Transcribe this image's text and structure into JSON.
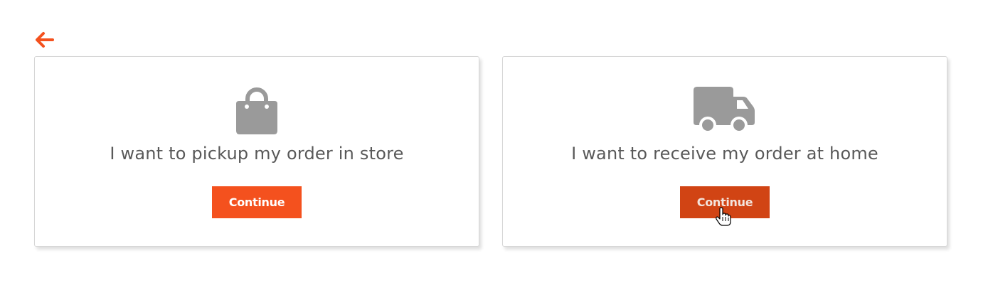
{
  "header": {
    "back_icon": "arrow-left-icon",
    "accent_color": "#f4511e"
  },
  "options": [
    {
      "id": "pickup",
      "icon": "shopping-bag-icon",
      "label": "I want to pickup my order in store",
      "button_label": "Continue"
    },
    {
      "id": "delivery",
      "icon": "truck-icon",
      "label": "I want to receive my order at home",
      "button_label": "Continue",
      "state": "hovered"
    }
  ],
  "colors": {
    "button": "#f4511e",
    "button_hover": "#d14414",
    "icon": "#9a9a9a",
    "text": "#595959"
  }
}
